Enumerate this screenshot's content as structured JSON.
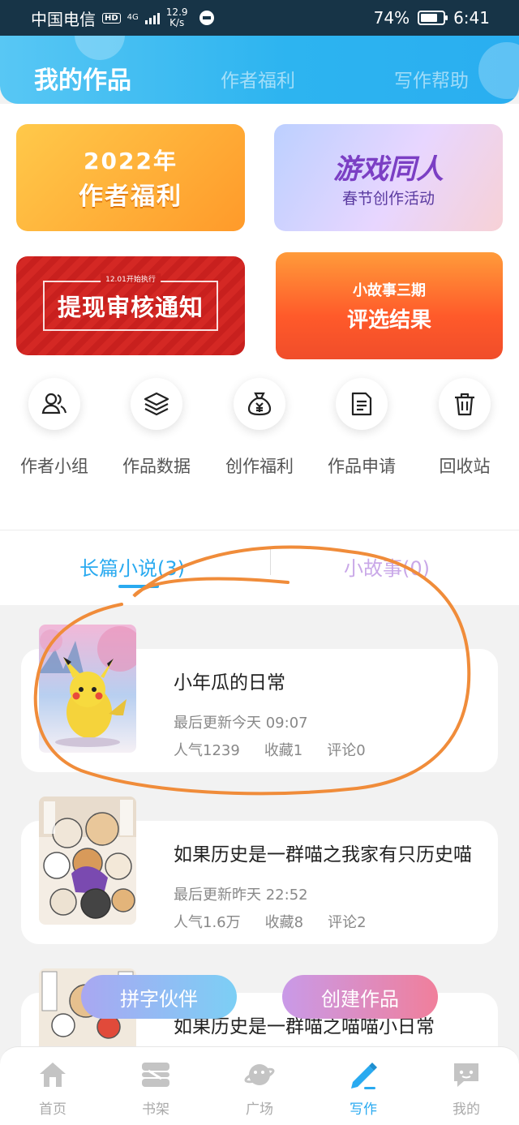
{
  "status_bar": {
    "carrier": "中国电信",
    "hd": "HD",
    "network": "4G",
    "speed_value": "12.9",
    "speed_unit": "K/s",
    "battery": "74%",
    "time": "6:41"
  },
  "header": {
    "tabs": [
      {
        "label": "我的作品",
        "active": true
      },
      {
        "label": "作者福利",
        "active": false
      },
      {
        "label": "写作帮助",
        "active": false
      }
    ]
  },
  "banners": [
    {
      "line1": "2022年",
      "line2": "作者福利"
    },
    {
      "line1": "游戏同人",
      "line2": "春节创作活动"
    },
    {
      "small": "12.01开始执行",
      "line1": "提现审核通知"
    },
    {
      "line1": "小故事三期",
      "line2": "评选结果"
    }
  ],
  "shortcuts": [
    {
      "label": "作者小组",
      "icon": "users-icon"
    },
    {
      "label": "作品数据",
      "icon": "layers-icon"
    },
    {
      "label": "创作福利",
      "icon": "money-bag-icon"
    },
    {
      "label": "作品申请",
      "icon": "document-icon"
    },
    {
      "label": "回收站",
      "icon": "trash-icon"
    }
  ],
  "work_tabs": [
    {
      "label": "长篇小说(3)",
      "active": true
    },
    {
      "label": "小故事(0)",
      "active": false
    }
  ],
  "works": [
    {
      "title": "小年瓜的日常",
      "updated": "最后更新今天 09:07",
      "popularity": "人气1239",
      "favorites": "收藏1",
      "comments": "评论0"
    },
    {
      "title": "如果历史是一群喵之我家有只历史喵",
      "updated": "最后更新昨天 22:52",
      "popularity": "人气1.6万",
      "favorites": "收藏8",
      "comments": "评论2"
    },
    {
      "title": "如果历史是一群喵之喵喵小日常"
    }
  ],
  "fab_buttons": {
    "partner": "拼字伙伴",
    "create": "创建作品"
  },
  "bottom_nav": [
    {
      "label": "首页",
      "icon": "home-icon",
      "active": false
    },
    {
      "label": "书架",
      "icon": "bookshelf-icon",
      "active": false
    },
    {
      "label": "广场",
      "icon": "planet-icon",
      "active": false
    },
    {
      "label": "写作",
      "icon": "pen-icon",
      "active": true
    },
    {
      "label": "我的",
      "icon": "chat-bubble-icon",
      "active": false
    }
  ],
  "colors": {
    "accent": "#29aaf0",
    "annotation": "#f08c3a"
  }
}
